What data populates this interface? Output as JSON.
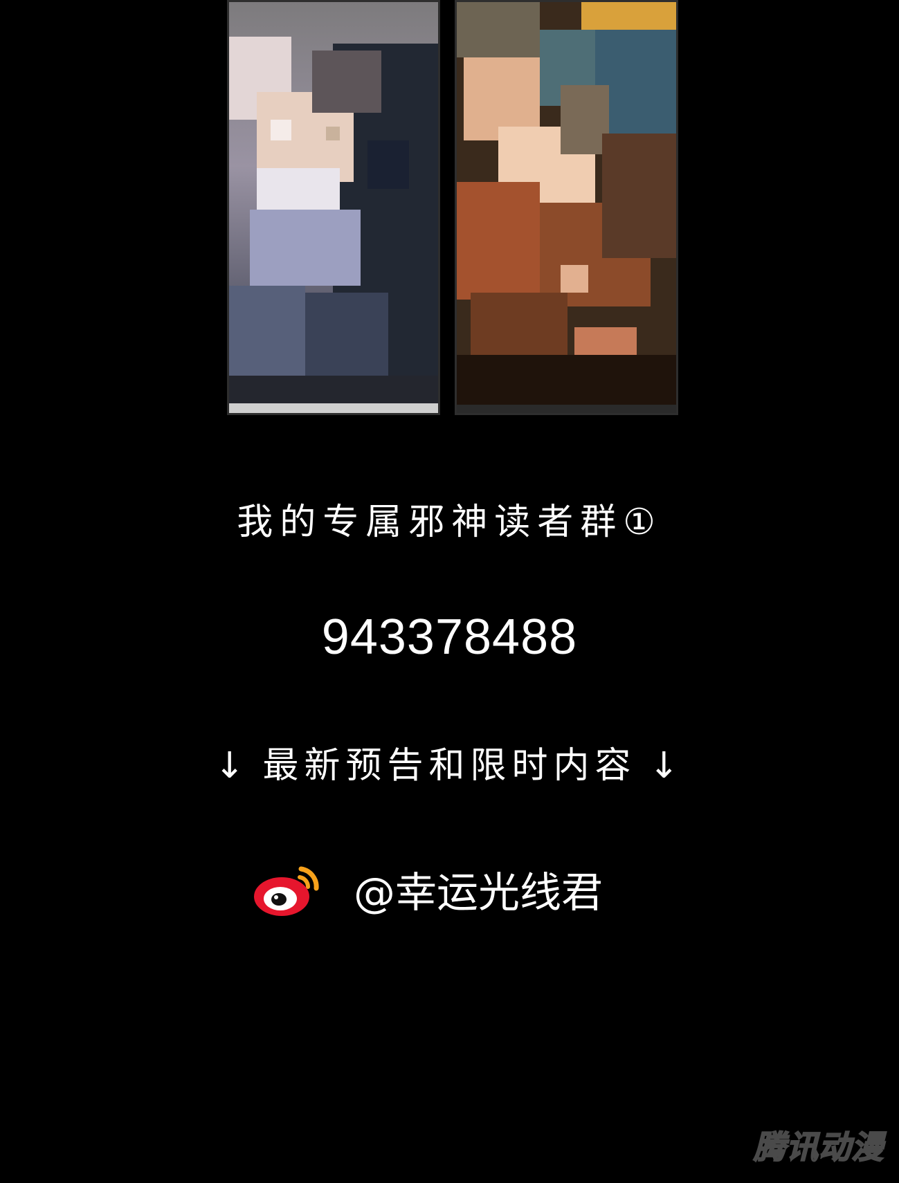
{
  "panels": [
    {
      "name": "pixelated-character-left",
      "blur": "mosaic"
    },
    {
      "name": "pixelated-character-right",
      "blur": "mosaic"
    }
  ],
  "group": {
    "title": "我的专属邪神读者群①",
    "number": "943378488"
  },
  "notice": {
    "arrow": "↓",
    "text": "最新预告和限时内容"
  },
  "weibo": {
    "icon": "weibo-icon",
    "handle": "@幸运光线君"
  },
  "watermark": "腾讯动漫",
  "colors": {
    "background": "#000000",
    "text": "#ffffff",
    "weibo_red": "#e6162d",
    "weibo_orange": "#f7a11b"
  }
}
